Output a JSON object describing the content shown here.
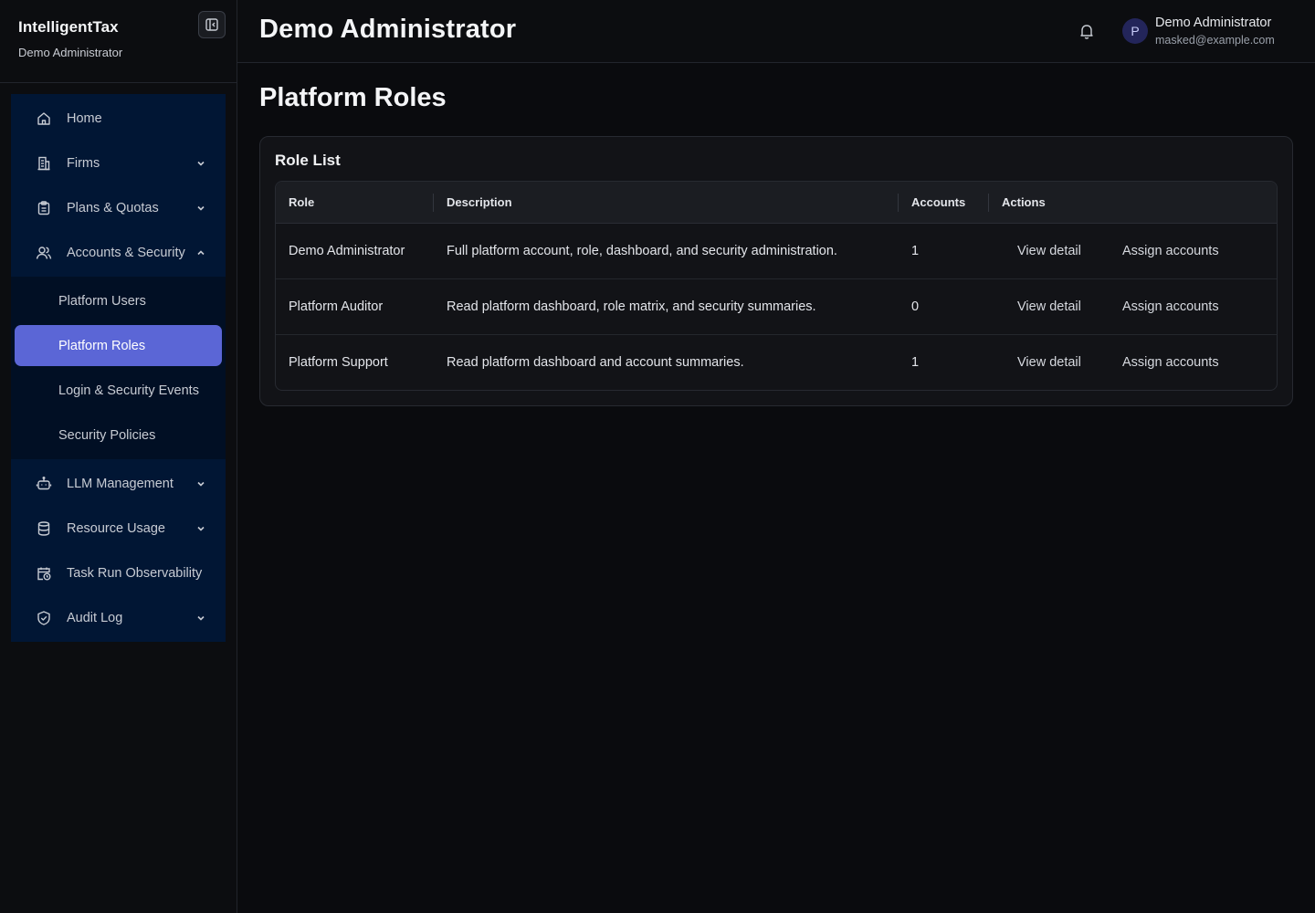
{
  "sidebar": {
    "brand_name": "IntelligentTax",
    "brand_sub": "Demo Administrator",
    "items": [
      {
        "label": "Home",
        "icon": "home-icon"
      },
      {
        "label": "Firms",
        "icon": "building-icon"
      },
      {
        "label": "Plans & Quotas",
        "icon": "clipboard-icon"
      },
      {
        "label": "Accounts & Security",
        "icon": "users-icon"
      },
      {
        "label": "LLM Management",
        "icon": "robot-icon"
      },
      {
        "label": "Resource Usage",
        "icon": "database-icon"
      },
      {
        "label": "Task Run Observability",
        "icon": "calendar-clock-icon"
      },
      {
        "label": "Audit Log",
        "icon": "shield-check-icon"
      }
    ],
    "subitems": [
      {
        "label": "Platform Users"
      },
      {
        "label": "Platform Roles"
      },
      {
        "label": "Login & Security Events"
      },
      {
        "label": "Security Policies"
      }
    ],
    "active_subitem": "Platform Roles"
  },
  "header": {
    "title": "Demo Administrator",
    "avatar_initial": "P",
    "user_name": "Demo Administrator",
    "user_email": "masked@example.com"
  },
  "main": {
    "page_title": "Platform Roles",
    "card_title": "Role List",
    "table": {
      "columns": [
        "Role",
        "Description",
        "Accounts",
        "Actions"
      ],
      "rows": [
        {
          "role": "Demo Administrator",
          "description": "Full platform account, role, dashboard, and security administration.",
          "accounts": "1",
          "view": "View detail",
          "assign": "Assign accounts"
        },
        {
          "role": "Platform Auditor",
          "description": "Read platform dashboard, role matrix, and security summaries.",
          "accounts": "0",
          "view": "View detail",
          "assign": "Assign accounts"
        },
        {
          "role": "Platform Support",
          "description": "Read platform dashboard and account summaries.",
          "accounts": "1",
          "view": "View detail",
          "assign": "Assign accounts"
        }
      ]
    }
  },
  "colors": {
    "accent": "#5b66d6",
    "nav_bg": "#011634",
    "page_bg": "#0a0b0e"
  }
}
